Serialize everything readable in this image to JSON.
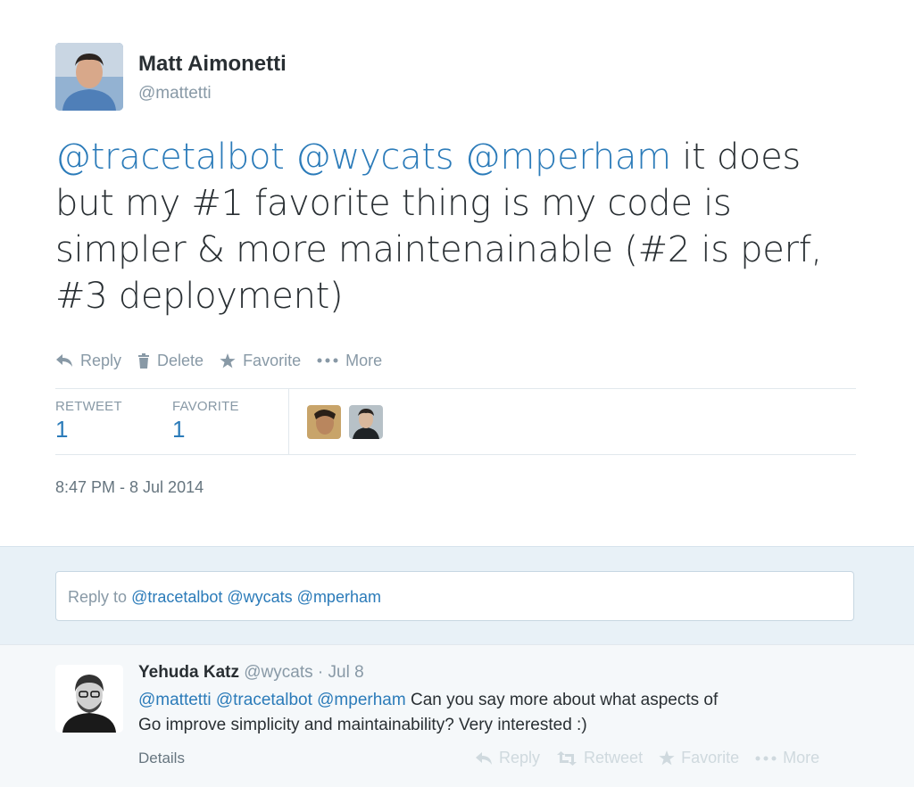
{
  "tweet": {
    "author_name": "Matt Aimonetti",
    "author_handle": "@mattetti",
    "mentions": [
      "@tracetalbot",
      "@wycats",
      "@mperham"
    ],
    "text_line1_rest": " it does",
    "text_line2": "but my #1 favorite thing is my code is",
    "text_line3": "simpler & more maintenainable (#2 is perf,",
    "text_line4": "#3 deployment)",
    "timestamp": "8:47 PM - 8 Jul 2014"
  },
  "actions": {
    "reply": "Reply",
    "delete": "Delete",
    "favorite": "Favorite",
    "more": "More"
  },
  "stats": {
    "retweet_label": "RETWEET",
    "retweet_count": "1",
    "favorite_label": "FAVORITE",
    "favorite_count": "1"
  },
  "reply_box": {
    "prefix": "Reply to",
    "mentions": "@tracetalbot @wycats @mperham"
  },
  "reply_tweet": {
    "name": "Yehuda Katz",
    "meta": "@wycats · Jul 8",
    "mentions": "@mattetti @tracetalbot @mperham",
    "text_rest": " Can you say more about what aspects of",
    "text_line2": "Go improve simplicity and maintainability? Very interested :)",
    "details": "Details",
    "actions": {
      "reply": "Reply",
      "retweet": "Retweet",
      "favorite": "Favorite",
      "more": "More"
    }
  },
  "colors": {
    "link": "#2b7bb9",
    "muted": "#8899a6",
    "reply_bg": "#e8f1f7"
  },
  "icons": [
    "reply-icon",
    "trash-icon",
    "star-icon",
    "more-dots-icon",
    "retweet-icon"
  ]
}
